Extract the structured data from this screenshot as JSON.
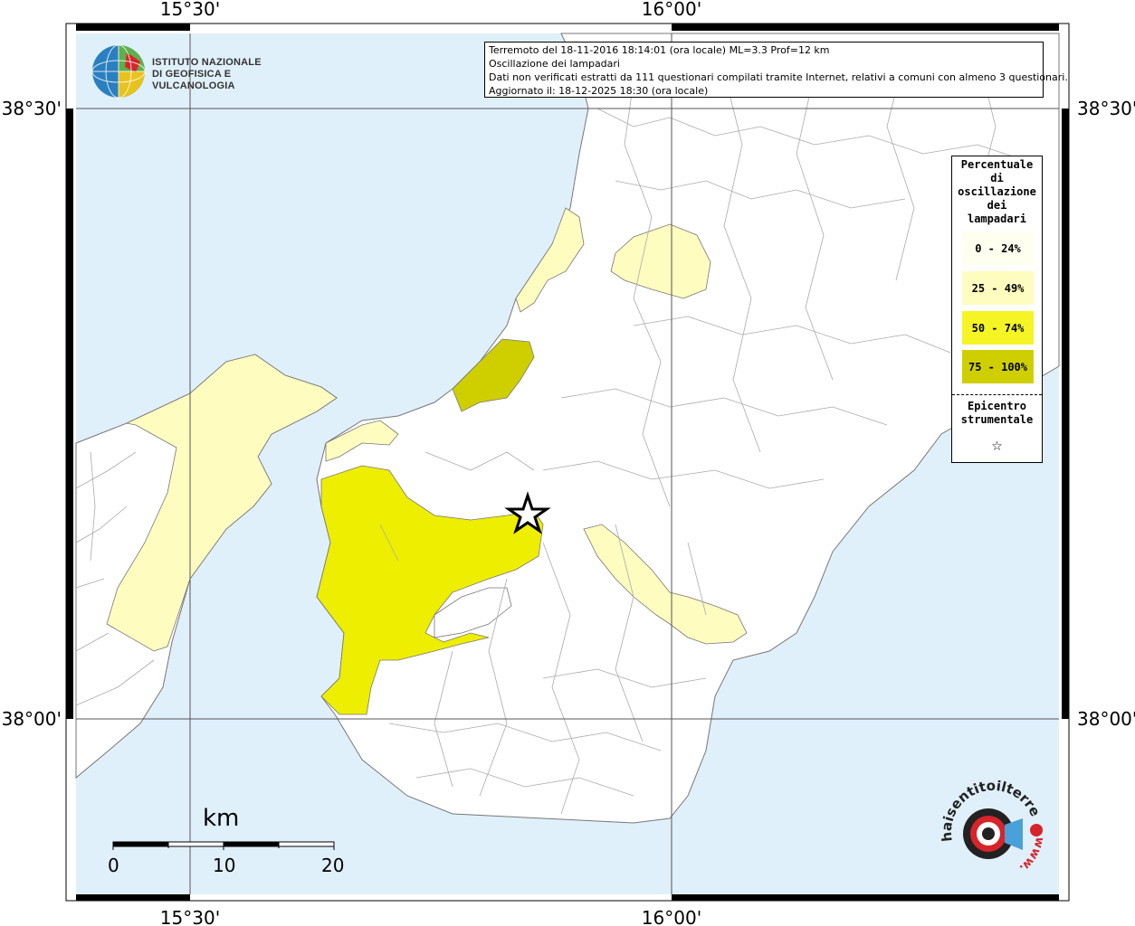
{
  "info": {
    "line1": "Terremoto del 18-11-2016 18:14:01 (ora locale) ML=3.3 Prof=12 km",
    "line2": "Oscillazione dei lampadari",
    "line3": "Dati non verificati estratti da 111 questionari compilati tramite Internet, relativi a comuni con almeno 3 questionari.",
    "line4": "Aggiornato il: 18-12-2025 18:30 (ora locale)"
  },
  "coords": {
    "lon_left": "15°30'",
    "lon_right": "16°00'",
    "lat_top": "38°30'",
    "lat_bottom": "38°00'"
  },
  "logo": {
    "line1": "ISTITUTO NAZIONALE",
    "line2": "DI GEOFISICA E VULCANOLOGIA"
  },
  "legend": {
    "title_lines": [
      "Percentuale",
      "di",
      "oscillazione",
      "dei",
      "lampadari"
    ],
    "classes": [
      {
        "label": "0 - 24%",
        "color": "#fffff0"
      },
      {
        "label": "25 - 49%",
        "color": "#fffcc0"
      },
      {
        "label": "50 - 74%",
        "color": "#f5f525"
      },
      {
        "label": "75 - 100%",
        "color": "#cfcf00"
      }
    ],
    "epicenter_lines": [
      "Epicentro",
      "strumentale"
    ],
    "epicenter_symbol": "☆"
  },
  "scale": {
    "unit": "km",
    "ticks": [
      "0",
      "10",
      "20"
    ]
  },
  "watermark": {
    "text": "haisentitoilterremoto.it",
    "www": "www."
  },
  "colors": {
    "sea": "#e0f0fb",
    "land": "#ffffff",
    "light_yellow": "#fffcc0",
    "yellow": "#eeee00",
    "olive": "#cfcf00"
  }
}
